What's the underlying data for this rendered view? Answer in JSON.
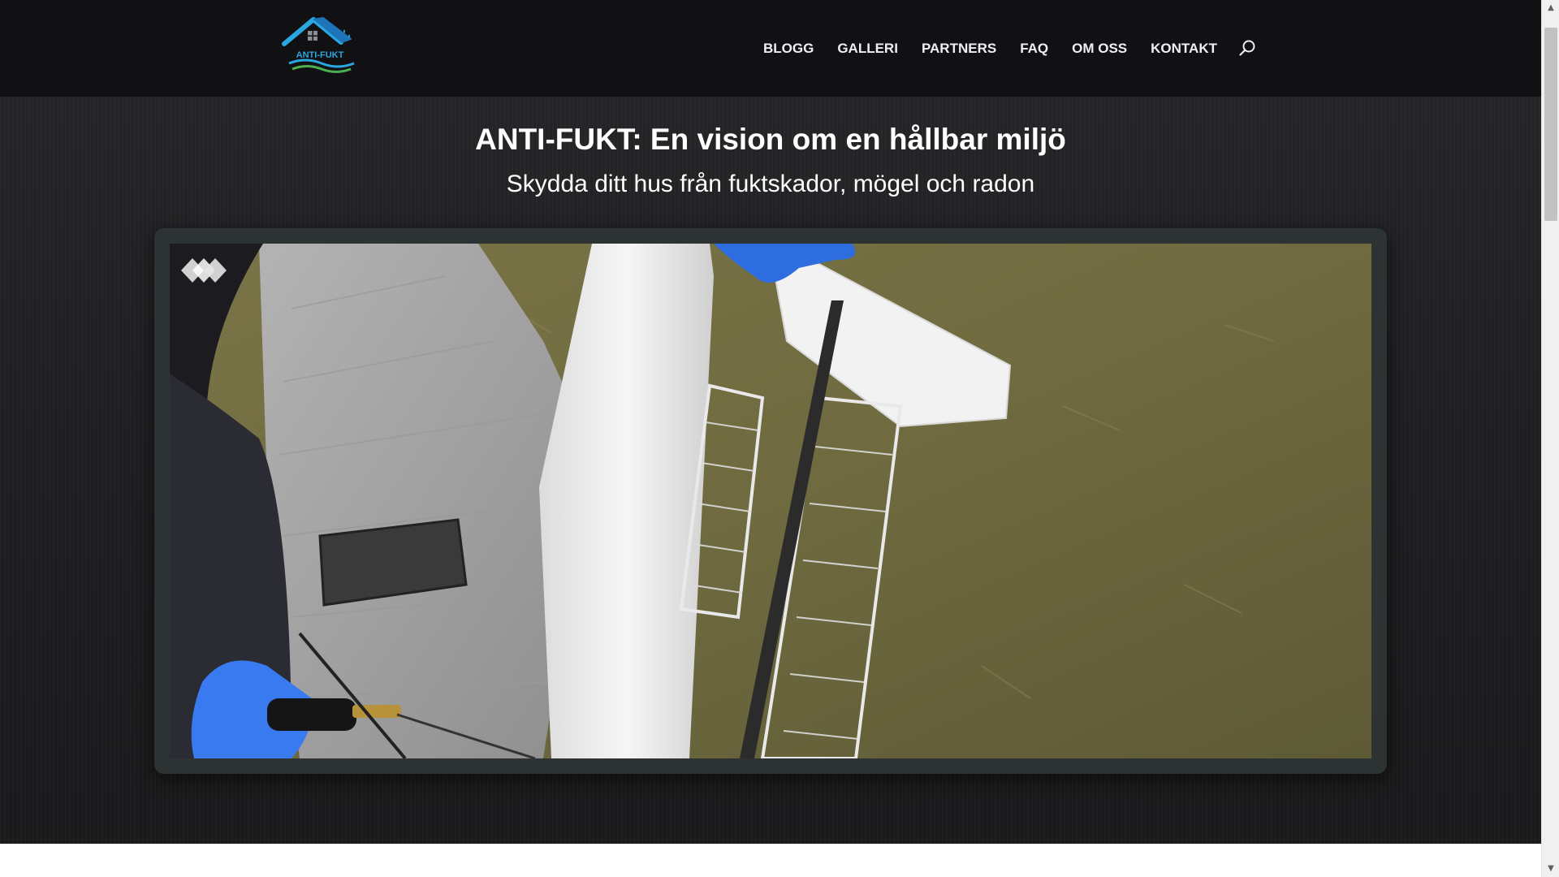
{
  "logo": {
    "text": "ANTI-FUKT"
  },
  "nav": {
    "items": [
      {
        "label": "BLOGG"
      },
      {
        "label": "GALLERI"
      },
      {
        "label": "PARTNERS"
      },
      {
        "label": "FAQ"
      },
      {
        "label": "OM OSS"
      },
      {
        "label": "KONTAKT"
      }
    ],
    "search_icon": "search-icon"
  },
  "hero": {
    "title": "ANTI-FUKT: En vision om en hållbar miljö",
    "subtitle": "Skydda ditt hus från fuktskador, mögel och radon"
  },
  "video": {
    "icon": "video-watermark-icon"
  },
  "colors": {
    "header_bg": "#111114",
    "hero_bg": "#222225",
    "frame": "#2c3332",
    "logo_blue": "#2aa7e0",
    "logo_green": "#4caf50"
  }
}
